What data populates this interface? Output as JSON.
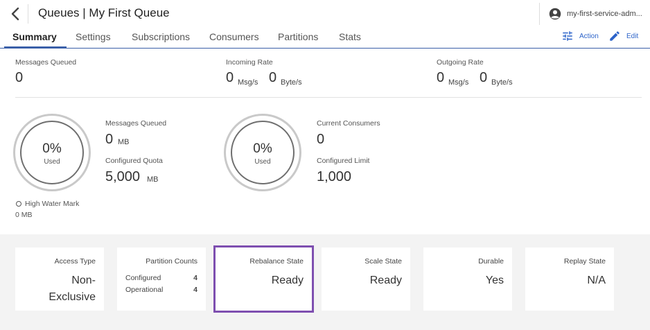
{
  "header": {
    "title": "Queues | My First Queue",
    "user": "my-first-service-adm..."
  },
  "tabs": [
    {
      "label": "Summary",
      "active": true
    },
    {
      "label": "Settings"
    },
    {
      "label": "Subscriptions"
    },
    {
      "label": "Consumers"
    },
    {
      "label": "Partitions"
    },
    {
      "label": "Stats"
    }
  ],
  "toolbar": {
    "action_label": "Action",
    "edit_label": "Edit",
    "accent_color": "#2c63c9"
  },
  "top_stats": {
    "messages_queued": {
      "label": "Messages Queued",
      "value": "0"
    },
    "incoming_rate": {
      "label": "Incoming Rate",
      "msg_value": "0",
      "msg_unit": "Msg/s",
      "byte_value": "0",
      "byte_unit": "Byte/s"
    },
    "outgoing_rate": {
      "label": "Outgoing Rate",
      "msg_value": "0",
      "msg_unit": "Msg/s",
      "byte_value": "0",
      "byte_unit": "Byte/s"
    }
  },
  "storage": {
    "gauge_pct": "0%",
    "gauge_caption": "Used",
    "messages_queued_label": "Messages Queued",
    "messages_queued_value": "0",
    "messages_queued_unit": "MB",
    "quota_label": "Configured Quota",
    "quota_value": "5,000",
    "quota_unit": "MB",
    "hwm_label": "High Water Mark",
    "hwm_value": "0 MB"
  },
  "consumers": {
    "gauge_pct": "0%",
    "gauge_caption": "Used",
    "current_label": "Current Consumers",
    "current_value": "0",
    "limit_label": "Configured Limit",
    "limit_value": "1,000"
  },
  "cards": {
    "access_type": {
      "label": "Access Type",
      "value_line1": "Non-",
      "value_line2": "Exclusive"
    },
    "partition_counts": {
      "label": "Partition Counts",
      "configured_label": "Configured",
      "configured_value": "4",
      "operational_label": "Operational",
      "operational_value": "4"
    },
    "rebalance_state": {
      "label": "Rebalance State",
      "value": "Ready",
      "highlight_color": "#7e4fb0"
    },
    "scale_state": {
      "label": "Scale State",
      "value": "Ready"
    },
    "durable": {
      "label": "Durable",
      "value": "Yes"
    },
    "replay_state": {
      "label": "Replay State",
      "value": "N/A"
    }
  }
}
